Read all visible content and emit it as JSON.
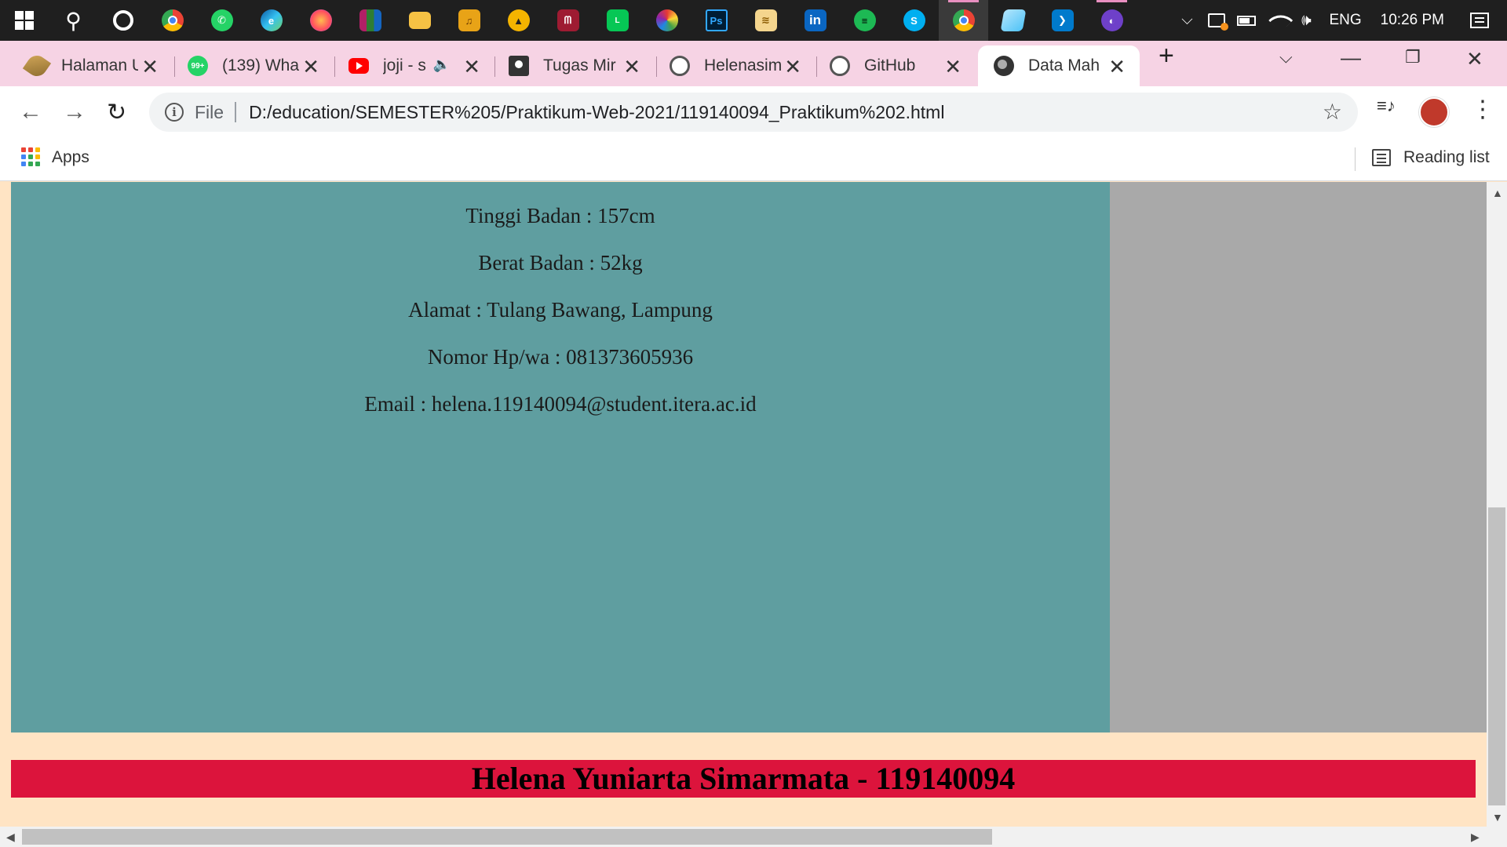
{
  "taskbar": {
    "apps": [
      {
        "name": "search",
        "glyph": "⚲"
      },
      {
        "name": "cortana",
        "glyph": "○"
      },
      {
        "name": "chrome",
        "glyph": "●"
      },
      {
        "name": "whatsapp",
        "glyph": "✆"
      },
      {
        "name": "edge",
        "glyph": "e"
      },
      {
        "name": "firefox",
        "glyph": "◉"
      },
      {
        "name": "winrar",
        "glyph": "▦"
      },
      {
        "name": "file-explorer",
        "glyph": "▭"
      },
      {
        "name": "music",
        "glyph": "♫"
      },
      {
        "name": "app-a",
        "glyph": "▲"
      },
      {
        "name": "mendeley",
        "glyph": "ᗰ"
      },
      {
        "name": "line",
        "glyph": "L"
      },
      {
        "name": "picasa",
        "glyph": "✿"
      },
      {
        "name": "photoshop",
        "glyph": "Ps"
      },
      {
        "name": "layers",
        "glyph": "≋"
      },
      {
        "name": "linkedin",
        "glyph": "in"
      },
      {
        "name": "spotify",
        "glyph": "≡"
      },
      {
        "name": "skype",
        "glyph": "S"
      },
      {
        "name": "chrome-profile",
        "glyph": "●"
      },
      {
        "name": "notepad",
        "glyph": "▤"
      },
      {
        "name": "vscode",
        "glyph": "❯"
      },
      {
        "name": "github-desktop",
        "glyph": "◐"
      }
    ],
    "tray": {
      "chevron": "⌵",
      "language": "ENG",
      "time": "10:26 PM"
    }
  },
  "tabs": [
    {
      "label": "Halaman U",
      "close": "✕"
    },
    {
      "label": "(139) Wha",
      "close": "✕",
      "badge": "99+"
    },
    {
      "label": "joji - s",
      "close": "✕",
      "audio": "🔈"
    },
    {
      "label": "Tugas Mir",
      "close": "✕"
    },
    {
      "label": "Helenasim",
      "close": "✕"
    },
    {
      "label": "GitHub",
      "close": "✕"
    },
    {
      "label": "Data Mah",
      "close": "✕"
    }
  ],
  "window_controls": {
    "tab_search": "⌵",
    "minimize": "—",
    "maximize": "❐",
    "close": "✕",
    "new_tab": "+"
  },
  "toolbar": {
    "back": "←",
    "forward": "→",
    "reload": "↻",
    "info": "i",
    "scheme": "File",
    "url": "D:/education/SEMESTER%205/Praktikum-Web-2021/119140094_Praktikum%202.html",
    "star": "☆",
    "menu": "⋮",
    "media": "≡♪"
  },
  "bookmarks": {
    "apps_label": "Apps",
    "reading_list_label": "Reading list"
  },
  "page": {
    "lines": [
      {
        "text": "Tinggi Badan : 157cm"
      },
      {
        "text": "Berat Badan : 52kg"
      },
      {
        "text": "Alamat : Tulang Bawang, Lampung"
      },
      {
        "text": "Nomor Hp/wa : 081373605936"
      },
      {
        "text": "Email : helena.119140094@student.itera.ac.id"
      }
    ],
    "footer": "Helena Yuniarta Simarmata - 119140094"
  },
  "colors": {
    "page_bg": "#ffe4c4",
    "main_bg": "#5f9ea0",
    "aside_bg": "#a9a9a9",
    "footer_bg": "#dc143c",
    "tab_strip": "#f6d3e4"
  }
}
